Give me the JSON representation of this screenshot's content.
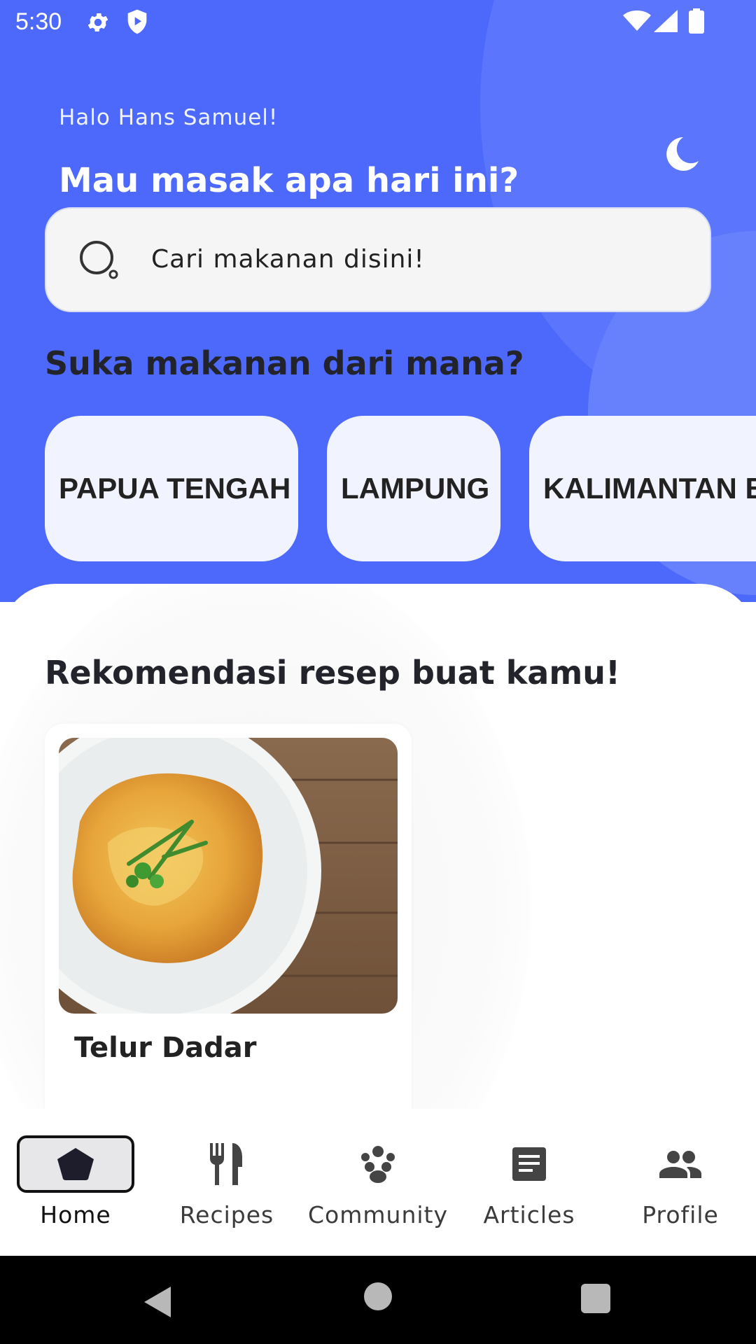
{
  "status_bar": {
    "time": "5:30",
    "icons": [
      "gear-icon",
      "shield-play-icon",
      "wifi-icon",
      "signal-icon",
      "battery-icon"
    ]
  },
  "header": {
    "greeting": "Halo Hans Samuel!",
    "headline": "Mau masak apa hari ini?",
    "theme_toggle_icon": "moon-icon"
  },
  "search": {
    "placeholder": "Cari makanan disini!",
    "icon": "search-icon"
  },
  "regions": {
    "title": "Suka makanan dari mana?",
    "chips": [
      "PAPUA TENGAH",
      "LAMPUNG",
      "KALIMANTAN B"
    ]
  },
  "recommendations": {
    "title": "Rekomendasi resep buat kamu!",
    "cards": [
      {
        "title": "Telur Dadar",
        "image": "omelette-plate-photo"
      }
    ]
  },
  "bottom_nav": {
    "items": [
      {
        "label": "Home",
        "icon": "home-icon",
        "active": true
      },
      {
        "label": "Recipes",
        "icon": "utensils-icon",
        "active": false
      },
      {
        "label": "Community",
        "icon": "community-icon",
        "active": false
      },
      {
        "label": "Articles",
        "icon": "article-icon",
        "active": false
      },
      {
        "label": "Profile",
        "icon": "people-icon",
        "active": false
      }
    ]
  },
  "colors": {
    "primary": "#4d69fb",
    "chip_bg": "#f1f4ff",
    "text_dark": "#22232b"
  }
}
